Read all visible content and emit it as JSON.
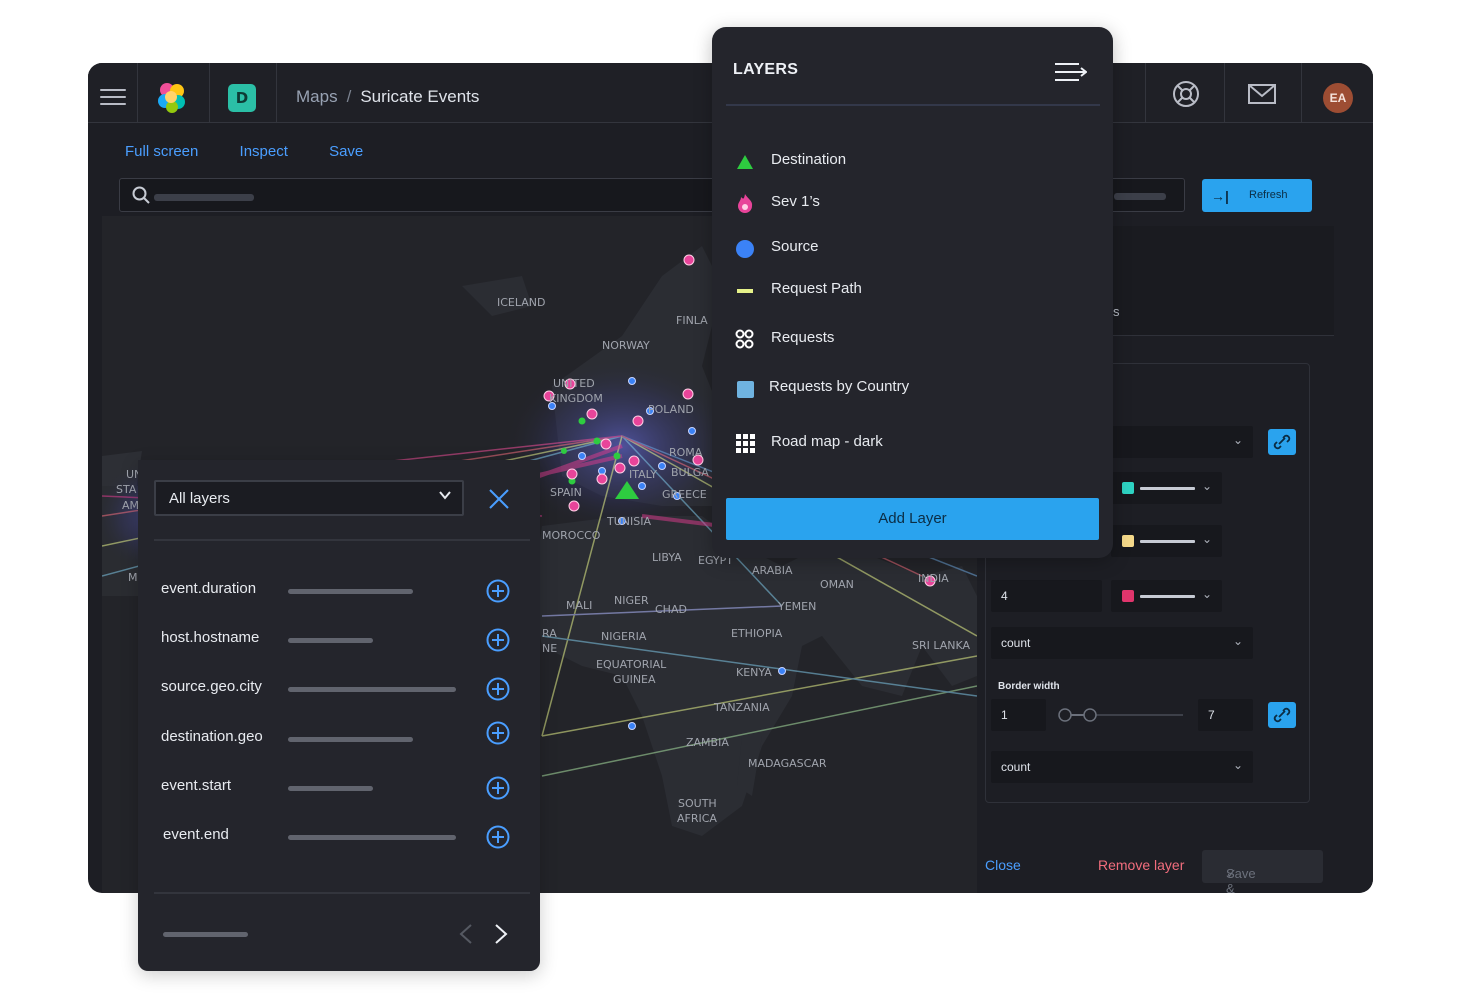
{
  "breadcrumb": {
    "parent": "Maps",
    "separator": "/",
    "current": "Suricate Events"
  },
  "space_badge": "D",
  "user": {
    "initials": "EA"
  },
  "toolbar": {
    "full_screen": "Full screen",
    "inspect": "Inspect",
    "save": "Save"
  },
  "refresh_label": "Refresh",
  "map_labels": [
    "ICELAND",
    "FINLA",
    "NORWAY",
    "UNITED",
    "KINGDOM",
    "POLAND",
    "ROMA",
    "BULGA",
    "ITALY",
    "GREECE",
    "SPAIN",
    "TUNISIA",
    "MOROCCO",
    "LIBYA",
    "EGYPT",
    "ARABIA",
    "OMAN",
    "INDIA",
    "MALI",
    "NIGER",
    "CHAD",
    "YEMEN",
    "NIGERIA",
    "ETHIOPIA",
    "SRI LANKA",
    "EQUATORIAL",
    "GUINEA",
    "KENYA",
    "TANZANIA",
    "ZAMBIA",
    "MADAGASCAR",
    "SOUTH",
    "AFRICA",
    "UN",
    "STA",
    "AM",
    "M",
    "RA",
    "NE"
  ],
  "layers_panel": {
    "title": "LAYERS",
    "items": [
      {
        "label": "Destination",
        "icon": "triangle-icon",
        "color": "#2ecc40"
      },
      {
        "label": "Sev 1’s",
        "icon": "flame-icon",
        "color": "#e8449a"
      },
      {
        "label": "Source",
        "icon": "circle-icon",
        "color": "#3b82f6"
      },
      {
        "label": "Request Path",
        "icon": "line-icon",
        "color": "#e6f28a"
      },
      {
        "label": "Requests",
        "icon": "cluster-icon",
        "color": "#ffffff"
      },
      {
        "label": "Requests by Country",
        "icon": "square-icon",
        "color": "#6fb3e0"
      },
      {
        "label": "Road map - dark",
        "icon": "grid-icon",
        "color": "#ffffff"
      }
    ],
    "add_layer": "Add Layer"
  },
  "filter_panel": {
    "select_value": "All layers",
    "fields": [
      {
        "label": "event.duration"
      },
      {
        "label": "host.hostname"
      },
      {
        "label": "source.geo.city"
      },
      {
        "label": "destination.geo"
      },
      {
        "label": "event.start"
      },
      {
        "label": "event.end"
      }
    ]
  },
  "edit_panel": {
    "partial_text": "s",
    "color_swatches": [
      "#2ed3c3",
      "#f5d98a",
      "#e0356c"
    ],
    "size_value": "4",
    "select1": "count",
    "border_width_label": "Border width",
    "border_min": "1",
    "border_max": "7",
    "select2": "count",
    "close": "Close",
    "remove_layer": "Remove layer",
    "save_close": "Save & close"
  }
}
